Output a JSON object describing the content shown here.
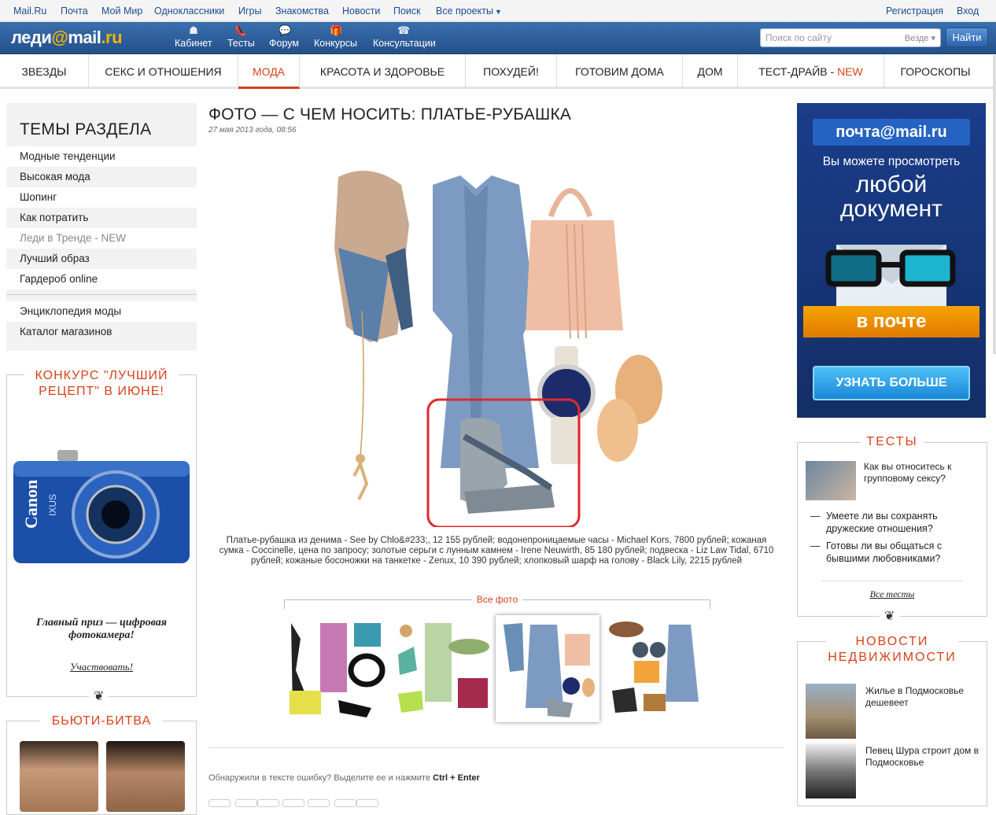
{
  "topbar": {
    "links": [
      "Mail.Ru",
      "Почта",
      "Мой Мир",
      "Одноклассники",
      "Игры",
      "Знакомства",
      "Новости",
      "Поиск",
      "Все проекты"
    ],
    "register": "Регистрация",
    "login": "Вход"
  },
  "header": {
    "logo_left": "леди",
    "logo_at": "@",
    "logo_right": "mail",
    "logo_dot": ".ru",
    "items": [
      "Кабинет",
      "Тесты",
      "Форум",
      "Конкурсы",
      "Консультации"
    ],
    "search_placeholder": "Поиск по сайту",
    "search_where": "Везде",
    "search_button": "Найти"
  },
  "nav": {
    "items": [
      "ЗВЕЗДЫ",
      "СЕКС И ОТНОШЕНИЯ",
      "МОДА",
      "КРАСОТА И ЗДОРОВЬЕ",
      "ПОХУДЕЙ!",
      "ГОТОВИМ ДОМА",
      "ДОМ",
      "ТЕСТ-ДРАЙВ - ",
      "ГОРОСКОПЫ"
    ],
    "new_label": "NEW",
    "active": "МОДА"
  },
  "sidebar": {
    "title": "ТЕМЫ РАЗДЕЛА",
    "items": [
      "Модные тенденции",
      "Высокая мода",
      "Шопинг",
      "Как потратить",
      "Леди в Тренде - NEW",
      "Лучший образ",
      "Гардероб online"
    ],
    "items2": [
      "Энциклопедия моды",
      "Каталог магазинов"
    ]
  },
  "contest": {
    "title_1": "КОНКУРС \"ЛУЧШИЙ",
    "title_2": "РЕЦЕПТ\" В ИЮНЕ!",
    "prize_1": "Главный приз — цифровая",
    "prize_2": "фотокамера!",
    "join": "Участвовать!",
    "camera_brand": "Canon",
    "camera_model": "IXUS"
  },
  "beauty": {
    "title": "БЬЮТИ-БИТВА"
  },
  "article": {
    "title": "ФОТО — С ЧЕМ НОСИТЬ: ПЛАТЬЕ-РУБАШКА",
    "date": "27 мая 2013 года, 08:56",
    "caption": "Платье-рубашка из денима - See by Chlo&#233;, 12 155 рублей; водонепроницаемые часы - Michael Kors, 7800 рублей; кожаная сумка - Coccinelle, цена по запросу; золотые серьги с лунным камнем - Irene Neuwirth, 85 180 рублей; подвеска - Liz Law Tidal, 6710 рублей; кожаные босоножки на танкетке - Zenux, 10 390 рублей; хлопковый шарф на голову - Black Lily, 2215 рублей",
    "all_photos": "Все фото",
    "error_note": "Обнаружили в тексте ошибку? Выделите ее и нажмите ",
    "error_keys": "Ctrl + Enter"
  },
  "ad": {
    "logo": "почта@mail.ru",
    "line1": "Вы можете просмотреть",
    "line2": "любой",
    "line3": "документ",
    "ribbon": "в почте",
    "button": "УЗНАТЬ БОЛЬШЕ"
  },
  "tests": {
    "title": "ТЕСТЫ",
    "featured": "Как вы относитесь к групповому сексу?",
    "items": [
      "Умеете ли вы сохранять дружеские отношения?",
      "Готовы ли вы общаться с бывшими любовниками?"
    ],
    "all": "Все тесты"
  },
  "realty": {
    "title_1": "НОВОСТИ",
    "title_2": "НЕДВИЖИМОСТИ",
    "items": [
      "Жилье в Подмосковье дешевеет",
      "Певец Шура строит дом в Подмосковье"
    ]
  },
  "colors": {
    "accent": "#d6421a",
    "header_blue": "#2b5c9a",
    "link": "#1a4d8f"
  }
}
